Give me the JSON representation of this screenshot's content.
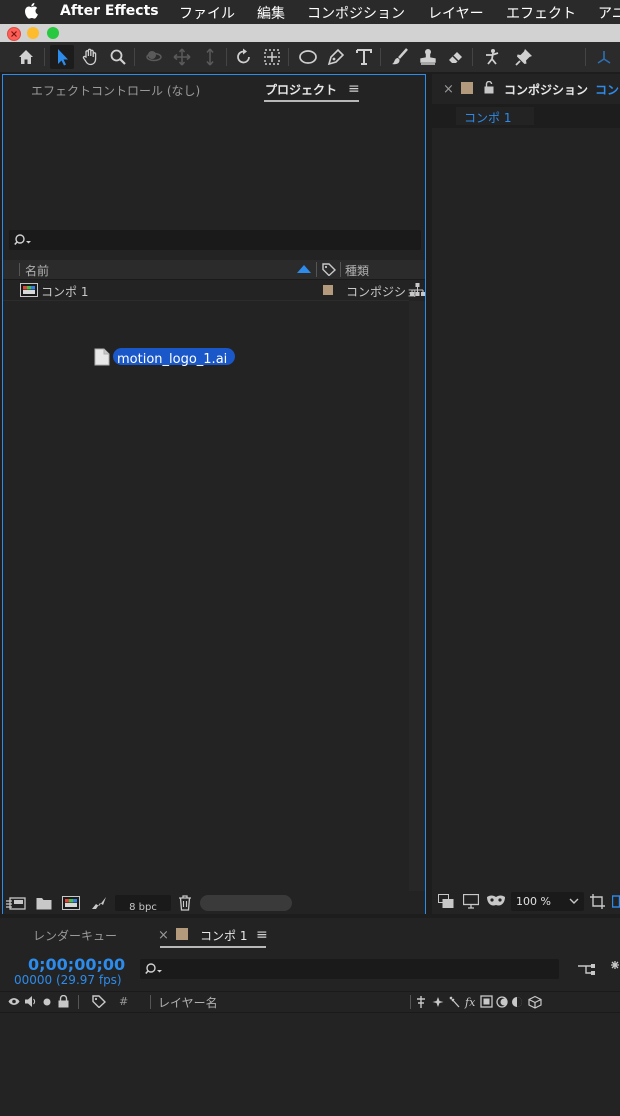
{
  "menubar": {
    "app_name": "After Effects",
    "items": [
      "ファイル",
      "編集",
      "コンポジション",
      "レイヤー",
      "エフェクト",
      "アニ"
    ]
  },
  "colors": {
    "accent": "#2d8ceb",
    "selection": "#1a57c8",
    "panel": "#232323",
    "label_tan": "#b49a7c"
  },
  "project_panel": {
    "tabs": [
      "エフェクトコントロール (なし)",
      "プロジェクト"
    ],
    "menu_icon": "≡",
    "search": {
      "placeholder": "",
      "value": ""
    },
    "columns": {
      "name": "名前",
      "type": "種類"
    },
    "items": [
      {
        "name": "コンポ 1",
        "type": "コンポジショ"
      }
    ],
    "dragging_file": "motion_logo_1.ai",
    "footer": {
      "bpc": "8 bpc"
    }
  },
  "comp_panel": {
    "close": "×",
    "tab_label": "コンポジション",
    "tab_suffix": "コン",
    "comp_tab": "コンポ 1",
    "zoom": "100 %"
  },
  "timeline": {
    "tabs": [
      "レンダーキュー",
      "コンポ 1"
    ],
    "close": "×",
    "menu_icon": "≡",
    "timecode": "0;00;00;00",
    "frame_info": "00000 (29.97 fps)",
    "search": {
      "placeholder": "",
      "value": ""
    },
    "columns": {
      "number": "#",
      "layer_name": "レイヤー名"
    }
  }
}
